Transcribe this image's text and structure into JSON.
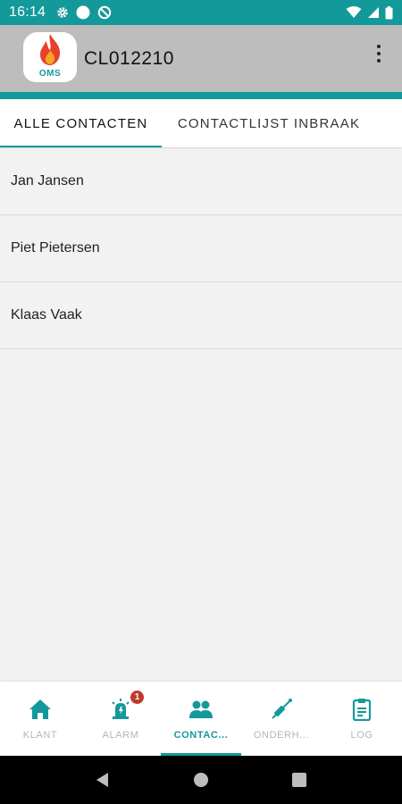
{
  "status_bar": {
    "time": "16:14"
  },
  "app_bar": {
    "logo_text": "OMS",
    "title": "CL012210"
  },
  "tabs": [
    {
      "label": "ALLE CONTACTEN",
      "selected": true
    },
    {
      "label": "CONTACTLIJST INBRAAK",
      "selected": false
    }
  ],
  "contacts": [
    {
      "name": "Jan Jansen"
    },
    {
      "name": "Piet Pietersen"
    },
    {
      "name": "Klaas Vaak"
    }
  ],
  "bottom_nav": {
    "items": [
      {
        "label": "KLANT",
        "icon": "home-icon"
      },
      {
        "label": "ALARM",
        "icon": "alarm-icon",
        "badge": "1"
      },
      {
        "label": "CONTAC...",
        "icon": "contacts-icon",
        "active": true
      },
      {
        "label": "ONDERH...",
        "icon": "maintenance-icon"
      },
      {
        "label": "LOG",
        "icon": "clipboard-icon"
      }
    ]
  },
  "colors": {
    "accent": "#14999a",
    "app_bar": "#bdbdbd",
    "badge": "#c0392b"
  }
}
